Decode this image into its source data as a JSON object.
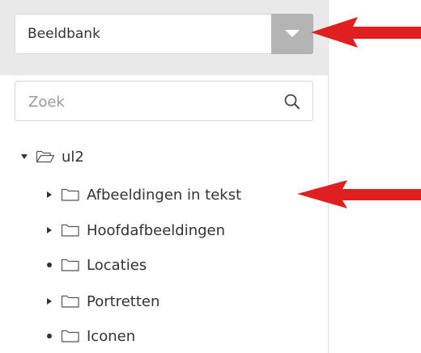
{
  "library_select": {
    "value": "Beeldbank"
  },
  "search": {
    "placeholder": "Zoek"
  },
  "tree": {
    "root": {
      "label": "ul2",
      "state": "expanded"
    },
    "children": [
      {
        "label": "Afbeeldingen in tekst",
        "state": "collapsed"
      },
      {
        "label": "Hoofdafbeeldingen",
        "state": "collapsed"
      },
      {
        "label": "Locaties",
        "state": "leaf"
      },
      {
        "label": "Portretten",
        "state": "collapsed"
      },
      {
        "label": "Iconen",
        "state": "leaf"
      }
    ]
  },
  "annotations": {
    "arrow_color": "#e02020"
  }
}
